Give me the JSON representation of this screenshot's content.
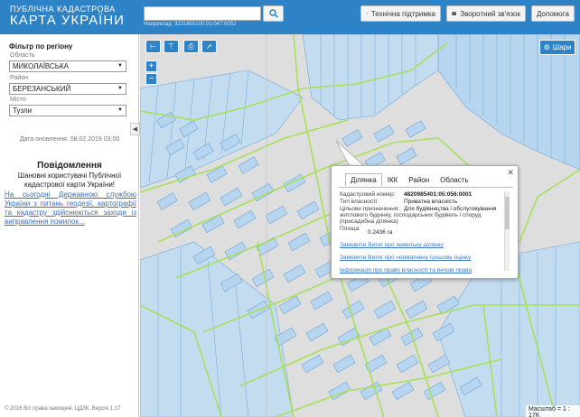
{
  "header": {
    "title_small": "ПУБЛІЧНА КАДАСТРОВА",
    "title_big": "КАРТА УКРАЇНИ",
    "search": {
      "value": "",
      "hint": "Наприклад: 3221655100:01:047:0052"
    },
    "buttons": {
      "support": "Технічна підтримка",
      "feedback": "Зворотний зв'язок",
      "help": "Допомога"
    }
  },
  "sidebar": {
    "filter_title": "Фільтр по регіону",
    "oblast": {
      "label": "Область",
      "value": "МИКОЛАЇВСЬКА"
    },
    "raion": {
      "label": "Район",
      "value": "БЕРЕЗАНСЬКИЙ"
    },
    "misto": {
      "label": "Місто",
      "value": "Тузли"
    },
    "update_date": "Дата оновлення: 08.02.2019 03:00",
    "notice_title": "Повідомлення",
    "notice_greeting": "Шановні користувачі Публічної кадастрової карти України!",
    "notice_link": "На сьогодні Державною службою України з питань геодезії, картографії та кадастру здійснюються заходи із виправлення помилок...",
    "copyright": "© 2016 Всі права захищені. ЦДЗК. Версія 1.17"
  },
  "map": {
    "layers_label": "Шари",
    "scale": "Масштаб = 1 : 17K"
  },
  "popup": {
    "tabs": [
      "Ділянка",
      "ІКК",
      "Район",
      "Область"
    ],
    "fields": {
      "cad_label": "Кадастровий номер:",
      "cad_value": "4820985401:05:056:0001",
      "type_label": "Тип власності:",
      "type_value": "Приватна власність",
      "purpose_label": "Цільове призначення:",
      "purpose_value": "Для будівництва і обслуговування",
      "purpose_cont": "житлового будинку, господарських будівель і споруд",
      "purpose_cont2": "(присадибна ділянка)",
      "area_label": "Площа:",
      "area_value": "0.2436 га"
    },
    "links": [
      "Замовити Витяг про земельну ділянку",
      "Замовити Витяг про нормативну грошову оцінку",
      "Інформація про право власності та речові права"
    ]
  },
  "colors": {
    "brand": "#2e83c6",
    "parcel_fill": "#b7d5ee",
    "parcel_stroke": "#6ea7d8",
    "boundary": "#a7e05a",
    "link": "#3a78c6"
  }
}
